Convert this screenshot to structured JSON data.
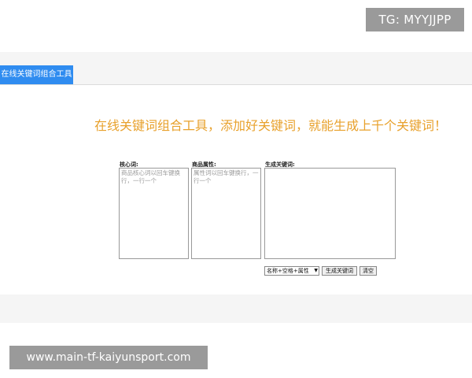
{
  "watermarks": {
    "top": "TG: MYYJJPP",
    "bottom": "www.main-tf-kaiyunsport.com"
  },
  "tabs": [
    {
      "label": "在线关键词组合工具",
      "active": true
    }
  ],
  "headline": "在线关键词组合工具，添加好关键词，就能生成上千个关键词！",
  "columns": {
    "core": {
      "label": "核心词:",
      "placeholder": "商品核心词以回车键换行，一行一个",
      "value": ""
    },
    "attr": {
      "label": "商品属性:",
      "placeholder": "属性词以回车键换行，一行一个",
      "value": ""
    },
    "output": {
      "label": "生成关键词:",
      "value": ""
    }
  },
  "controls": {
    "mode": {
      "selected": "名称+空格+属性"
    },
    "generate_label": "生成关键词",
    "clear_label": "清空"
  },
  "colors": {
    "tab_active": "#2f8cf0",
    "headline": "#e8a12c",
    "band": "#f5f5f5",
    "watermark_bg": "#9a9a9a"
  }
}
